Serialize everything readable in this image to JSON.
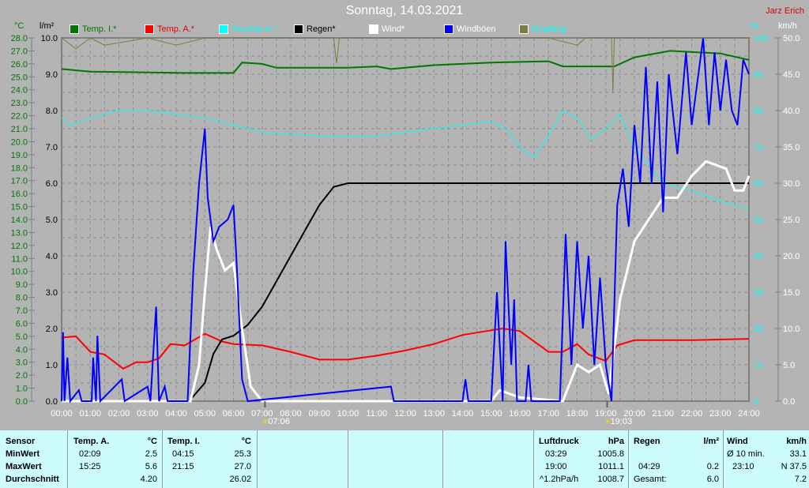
{
  "header": {
    "title": "Sonntag, 14.03.2021",
    "author": "Jarz Erich"
  },
  "legend": [
    {
      "label": "Temp. I.*",
      "color": "#007800",
      "text_color": "#007800"
    },
    {
      "label": "Temp. A.*",
      "color": "#ff0000",
      "text_color": "#e00000"
    },
    {
      "label": "Feuchte A.*",
      "color": "#00ffff",
      "text_color": "#00ffff"
    },
    {
      "label": "Regen*",
      "color": "#000000",
      "text_color": "#000000"
    },
    {
      "label": "Wind*",
      "color": "#ffffff",
      "text_color": "#ffffff"
    },
    {
      "label": "Windböen",
      "color": "#0000ff",
      "text_color": "#ffffff"
    },
    {
      "label": "Empfang",
      "color": "#7c7c40",
      "text_color": "#00ffff"
    }
  ],
  "chart_data": {
    "type": "line",
    "title": "Sonntag, 14.03.2021",
    "x_unit": "hours",
    "xlim": [
      0,
      24
    ],
    "x_ticks": [
      "00:00",
      "01:00",
      "02:00",
      "03:00",
      "04:00",
      "05:00",
      "06:00",
      "07:00",
      "08:00",
      "09:00",
      "10:00",
      "11:00",
      "12:00",
      "13:00",
      "14:00",
      "15:00",
      "16:00",
      "17:00",
      "18:00",
      "19:00",
      "20:00",
      "21:00",
      "22:00",
      "23:00",
      "24:00"
    ],
    "axes": {
      "temp": {
        "label": "°C",
        "range": [
          0,
          28
        ],
        "ticks": [
          "0.0",
          "1.0",
          "2.0",
          "3.0",
          "4.0",
          "5.0",
          "6.0",
          "7.0",
          "8.0",
          "9.0",
          "10.0",
          "11.0",
          "12.0",
          "13.0",
          "14.0",
          "15.0",
          "16.0",
          "17.0",
          "18.0",
          "19.0",
          "20.0",
          "21.0",
          "22.0",
          "23.0",
          "24.0",
          "25.0",
          "26.0",
          "27.0",
          "28.0"
        ]
      },
      "rain": {
        "label": "l/m²",
        "range": [
          0,
          10
        ],
        "ticks": [
          "0.0",
          "1.0",
          "2.0",
          "3.0",
          "4.0",
          "5.0",
          "6.0",
          "7.0",
          "8.0",
          "9.0",
          "10.0"
        ]
      },
      "humidity": {
        "label": "%",
        "range": [
          0,
          100
        ],
        "ticks": [
          "0",
          "10",
          "20",
          "30",
          "40",
          "50",
          "60",
          "70",
          "80",
          "90",
          "100"
        ]
      },
      "wind": {
        "label": "km/h",
        "range": [
          0,
          50
        ],
        "ticks": [
          "0.0",
          "5.0",
          "10.0",
          "15.0",
          "20.0",
          "25.0",
          "30.0",
          "35.0",
          "40.0",
          "45.0",
          "50.0"
        ]
      }
    },
    "series": [
      {
        "name": "Temp. I.*",
        "axis": "temp",
        "color": "#007800",
        "points": [
          [
            0,
            25.6
          ],
          [
            1,
            25.4
          ],
          [
            4.25,
            25.3
          ],
          [
            6,
            25.3
          ],
          [
            6.3,
            26.1
          ],
          [
            7,
            26.0
          ],
          [
            7.5,
            25.7
          ],
          [
            10,
            25.7
          ],
          [
            11,
            25.8
          ],
          [
            11.5,
            25.6
          ],
          [
            12,
            25.7
          ],
          [
            13,
            25.9
          ],
          [
            15,
            26.1
          ],
          [
            17,
            26.2
          ],
          [
            17.5,
            25.8
          ],
          [
            19.3,
            25.8
          ],
          [
            20,
            26.5
          ],
          [
            21.25,
            27.0
          ],
          [
            23,
            26.8
          ],
          [
            24,
            26.3
          ]
        ]
      },
      {
        "name": "Temp. A.*",
        "axis": "temp",
        "color": "#ff0000",
        "points": [
          [
            0,
            4.9
          ],
          [
            0.5,
            5.0
          ],
          [
            1,
            3.8
          ],
          [
            1.5,
            3.6
          ],
          [
            2.15,
            2.5
          ],
          [
            2.6,
            3.0
          ],
          [
            3,
            3.0
          ],
          [
            3.4,
            3.3
          ],
          [
            3.8,
            4.4
          ],
          [
            4.3,
            4.3
          ],
          [
            5,
            5.2
          ],
          [
            5.6,
            4.6
          ],
          [
            6,
            4.4
          ],
          [
            7,
            4.3
          ],
          [
            8,
            3.8
          ],
          [
            9,
            3.2
          ],
          [
            10,
            3.2
          ],
          [
            11,
            3.5
          ],
          [
            12,
            3.9
          ],
          [
            13,
            4.4
          ],
          [
            14,
            5.1
          ],
          [
            15.4,
            5.6
          ],
          [
            16,
            5.4
          ],
          [
            17,
            3.8
          ],
          [
            17.5,
            3.8
          ],
          [
            18,
            4.4
          ],
          [
            18.4,
            3.6
          ],
          [
            19,
            3.1
          ],
          [
            19.4,
            4.3
          ],
          [
            20,
            4.7
          ],
          [
            22,
            4.7
          ],
          [
            24,
            4.8
          ]
        ]
      },
      {
        "name": "Feuchte A.*",
        "axis": "humidity",
        "color": "#00ffff",
        "points": [
          [
            0,
            78
          ],
          [
            0.3,
            76
          ],
          [
            1,
            78
          ],
          [
            2,
            80
          ],
          [
            3,
            80
          ],
          [
            4,
            79
          ],
          [
            5,
            78
          ],
          [
            6,
            76
          ],
          [
            7,
            74
          ],
          [
            8,
            73.5
          ],
          [
            9,
            73
          ],
          [
            10,
            73
          ],
          [
            11,
            73
          ],
          [
            12,
            74
          ],
          [
            13,
            75
          ],
          [
            14,
            76
          ],
          [
            15,
            77
          ],
          [
            15.5,
            75
          ],
          [
            16,
            70
          ],
          [
            16.5,
            67
          ],
          [
            17,
            73
          ],
          [
            17.5,
            80
          ],
          [
            18,
            78
          ],
          [
            18.5,
            72
          ],
          [
            19,
            75
          ],
          [
            19.5,
            79
          ],
          [
            20,
            70
          ],
          [
            21,
            60
          ],
          [
            22,
            58
          ],
          [
            23,
            55
          ],
          [
            24,
            53
          ]
        ]
      },
      {
        "name": "Regen*",
        "axis": "rain",
        "color": "#000000",
        "points": [
          [
            0,
            0
          ],
          [
            4.45,
            0
          ],
          [
            5,
            0.5
          ],
          [
            5.3,
            1.3
          ],
          [
            5.6,
            1.7
          ],
          [
            6,
            1.8
          ],
          [
            6.5,
            2.1
          ],
          [
            7,
            2.6
          ],
          [
            7.5,
            3.3
          ],
          [
            8,
            4.0
          ],
          [
            8.5,
            4.7
          ],
          [
            9,
            5.4
          ],
          [
            9.5,
            5.9
          ],
          [
            10,
            6.0
          ],
          [
            24,
            6.0
          ]
        ]
      },
      {
        "name": "Wind*",
        "axis": "wind",
        "color": "#ffffff",
        "points": [
          [
            0,
            0
          ],
          [
            4.5,
            0
          ],
          [
            4.8,
            5
          ],
          [
            5,
            15
          ],
          [
            5.2,
            24
          ],
          [
            5.4,
            21
          ],
          [
            5.7,
            18
          ],
          [
            6,
            19
          ],
          [
            6.3,
            10
          ],
          [
            6.6,
            2
          ],
          [
            7,
            0
          ],
          [
            15,
            0
          ],
          [
            15.3,
            1.5
          ],
          [
            16,
            0.5
          ],
          [
            17.5,
            0
          ],
          [
            17.7,
            2
          ],
          [
            18,
            5
          ],
          [
            18.4,
            4
          ],
          [
            18.8,
            5
          ],
          [
            19.1,
            1
          ],
          [
            19.5,
            14
          ],
          [
            20,
            22
          ],
          [
            20.5,
            25
          ],
          [
            21,
            28
          ],
          [
            21.5,
            28
          ],
          [
            22,
            31
          ],
          [
            22.5,
            33
          ],
          [
            23.2,
            32
          ],
          [
            23.5,
            29
          ],
          [
            23.8,
            29
          ],
          [
            24,
            31
          ]
        ]
      },
      {
        "name": "Windböen",
        "axis": "wind",
        "color": "#0000ff",
        "points": [
          [
            0,
            0
          ],
          [
            0.05,
            9.5
          ],
          [
            0.1,
            0
          ],
          [
            0.2,
            6
          ],
          [
            0.3,
            0
          ],
          [
            0.6,
            1.5
          ],
          [
            0.7,
            0
          ],
          [
            1.05,
            0
          ],
          [
            1.1,
            6
          ],
          [
            1.2,
            0
          ],
          [
            1.25,
            9
          ],
          [
            1.35,
            0
          ],
          [
            2.1,
            3
          ],
          [
            2.2,
            0
          ],
          [
            3.0,
            2
          ],
          [
            3.1,
            0
          ],
          [
            3.3,
            13
          ],
          [
            3.4,
            0
          ],
          [
            3.6,
            2
          ],
          [
            3.7,
            0
          ],
          [
            4.4,
            0
          ],
          [
            4.6,
            18
          ],
          [
            4.8,
            30
          ],
          [
            5.0,
            37.5
          ],
          [
            5.1,
            28
          ],
          [
            5.3,
            22
          ],
          [
            5.5,
            24
          ],
          [
            5.8,
            25
          ],
          [
            6.0,
            27
          ],
          [
            6.1,
            20
          ],
          [
            6.3,
            3
          ],
          [
            6.5,
            0
          ],
          [
            11.5,
            2
          ],
          [
            11.6,
            0
          ],
          [
            14.0,
            0
          ],
          [
            14.1,
            3
          ],
          [
            14.2,
            0
          ],
          [
            15.0,
            0
          ],
          [
            15.2,
            15
          ],
          [
            15.4,
            0
          ],
          [
            15.5,
            22
          ],
          [
            15.7,
            5
          ],
          [
            15.8,
            14
          ],
          [
            15.9,
            0
          ],
          [
            16.2,
            0
          ],
          [
            16.3,
            5
          ],
          [
            16.4,
            0
          ],
          [
            17.4,
            0
          ],
          [
            17.6,
            23
          ],
          [
            17.8,
            5
          ],
          [
            18.0,
            22
          ],
          [
            18.2,
            10
          ],
          [
            18.4,
            20
          ],
          [
            18.6,
            5
          ],
          [
            18.8,
            17
          ],
          [
            19.0,
            5
          ],
          [
            19.2,
            0
          ],
          [
            19.4,
            27
          ],
          [
            19.6,
            32
          ],
          [
            19.8,
            24
          ],
          [
            20.0,
            38
          ],
          [
            20.2,
            30
          ],
          [
            20.4,
            46
          ],
          [
            20.6,
            30
          ],
          [
            20.8,
            44
          ],
          [
            21.0,
            26
          ],
          [
            21.2,
            45
          ],
          [
            21.5,
            34
          ],
          [
            21.8,
            48
          ],
          [
            22.0,
            38
          ],
          [
            22.2,
            44
          ],
          [
            22.4,
            50
          ],
          [
            22.6,
            38
          ],
          [
            22.8,
            48
          ],
          [
            23.0,
            40
          ],
          [
            23.2,
            47
          ],
          [
            23.4,
            40
          ],
          [
            23.6,
            38
          ],
          [
            23.8,
            47
          ],
          [
            24,
            45
          ]
        ]
      },
      {
        "name": "Empfang",
        "axis": "humidity",
        "color": "#7c7c40",
        "points": [
          [
            0,
            100
          ],
          [
            0.5,
            97
          ],
          [
            1,
            100
          ],
          [
            1.5,
            98
          ],
          [
            3,
            100
          ],
          [
            4,
            98
          ],
          [
            5,
            100
          ],
          [
            9.5,
            100
          ],
          [
            9.6,
            93
          ],
          [
            9.7,
            100
          ],
          [
            17,
            100
          ],
          [
            18,
            98
          ],
          [
            18.3,
            100
          ],
          [
            19.2,
            100
          ],
          [
            19.25,
            85
          ],
          [
            19.3,
            100
          ],
          [
            24,
            100
          ]
        ]
      }
    ],
    "markers": [
      {
        "label": "07:06",
        "hour": 7.1,
        "type": "sunrise"
      },
      {
        "label": "19:03",
        "hour": 19.05,
        "type": "sunset"
      }
    ]
  },
  "table": {
    "rows": [
      "Sensor",
      "MinWert",
      "MaxWert",
      "Durchschnitt"
    ],
    "temp_a": {
      "title": "Temp. A.",
      "unit": "°C",
      "min_time": "02:09",
      "min": "2.5",
      "max_time": "15:25",
      "max": "5.6",
      "avg": "4.20"
    },
    "temp_i": {
      "title": "Temp. I.",
      "unit": "°C",
      "min_time": "04:15",
      "min": "25.3",
      "max_time": "21:15",
      "max": "27.0",
      "avg": "26.02"
    },
    "pressure": {
      "title": "Luftdruck",
      "unit": "hPa",
      "min_time": "03:29",
      "min": "1005.8",
      "max_time": "19:00",
      "max": "1011.1",
      "trend": "^1.2hPa/h",
      "avg": "1008.7"
    },
    "rain": {
      "title": "Regen",
      "unit": "l/m²",
      "max_time": "04:29",
      "max": "0.2",
      "total_label": "Gesamt:",
      "total": "6.0"
    },
    "wind": {
      "title": "Wind",
      "unit": "km/h",
      "avg10_label": "Ø 10 min.",
      "avg10": "33.1",
      "max_time": "23:10",
      "max": "N 37.5",
      "avg": "7.2"
    }
  }
}
